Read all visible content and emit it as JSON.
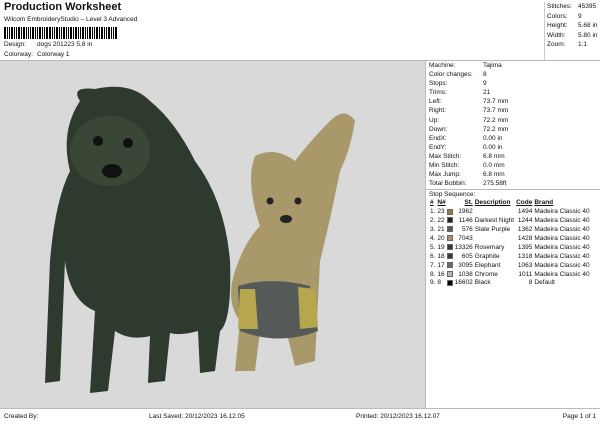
{
  "header": {
    "title": "Production Worksheet",
    "subtitle": "Wilcom EmbroideryStudio – Level 3 Advanced",
    "design_label": "Design:",
    "design_value": "dogs 201223 5,8 in",
    "colorway_label": "Colorway:",
    "colorway_value": "Colorway 1"
  },
  "stats": [
    {
      "label": "Stitches:",
      "value": "45395"
    },
    {
      "label": "Colors:",
      "value": "9"
    },
    {
      "label": "Height:",
      "value": "5.68 in"
    },
    {
      "label": "Width:",
      "value": "5.80 in"
    },
    {
      "label": "Zoom:",
      "value": "1:1"
    }
  ],
  "info": [
    {
      "label": "Machine:",
      "value": "Tajima"
    },
    {
      "label": "Color changes:",
      "value": "8"
    },
    {
      "label": "Stops:",
      "value": "9"
    },
    {
      "label": "Trims:",
      "value": "21"
    },
    {
      "label": "Left:",
      "value": "73.7 mm"
    },
    {
      "label": "Right:",
      "value": "73.7 mm"
    },
    {
      "label": "Up:",
      "value": "72.2 mm"
    },
    {
      "label": "Down:",
      "value": "72.2 mm"
    },
    {
      "label": "EndX:",
      "value": "0.00 in"
    },
    {
      "label": "EndY:",
      "value": "0.00 in"
    },
    {
      "label": "Max Stitch:",
      "value": "6.8 mm"
    },
    {
      "label": "Min Stitch:",
      "value": "0.0 mm"
    },
    {
      "label": "Max Jump:",
      "value": "6.8 mm"
    },
    {
      "label": "Total Bobbin:",
      "value": "275.58ft"
    }
  ],
  "stop_sequence": {
    "label": "Stop Sequence:",
    "headers": [
      "#",
      "N#",
      "St.",
      "Description",
      "Code",
      "Brand"
    ],
    "rows": [
      {
        "n": "1.",
        "nn": "23",
        "color": "#8c7d42",
        "st": "1962",
        "desc": "",
        "code": "1494",
        "brand": "Madeira Classic 40"
      },
      {
        "n": "2.",
        "nn": "22",
        "color": "#1e2421",
        "st": "1146",
        "desc": "Darkest Night",
        "code": "1244",
        "brand": "Madeira Classic 40"
      },
      {
        "n": "3.",
        "nn": "21",
        "color": "#56576b",
        "st": "576",
        "desc": "Slate Purple",
        "code": "1362",
        "brand": "Madeira Classic 40"
      },
      {
        "n": "4.",
        "nn": "20",
        "color": "#a39274",
        "st": "7043",
        "desc": "",
        "code": "1428",
        "brand": "Madeira Classic 40"
      },
      {
        "n": "5.",
        "nn": "19",
        "color": "#2d3a2e",
        "st": "13326",
        "desc": "Rosemary",
        "code": "1395",
        "brand": "Madeira Classic 40"
      },
      {
        "n": "6.",
        "nn": "18",
        "color": "#383c3d",
        "st": "605",
        "desc": "Graphite",
        "code": "1318",
        "brand": "Madeira Classic 40"
      },
      {
        "n": "7.",
        "nn": "17",
        "color": "#6c6f5b",
        "st": "3095",
        "desc": "Elephant",
        "code": "1063",
        "brand": "Madeira Classic 40"
      },
      {
        "n": "8.",
        "nn": "16",
        "color": "#b3bbbe",
        "st": "1038",
        "desc": "Chrome",
        "code": "1011",
        "brand": "Madeira Classic 40"
      },
      {
        "n": "9.",
        "nn": "8",
        "color": "#000000",
        "st": "16602",
        "desc": "Black",
        "code": "8",
        "brand": "Default"
      }
    ]
  },
  "footer": {
    "created_by": "Created By:",
    "last_saved": "Last Saved: 20/12/2023 16.12.05",
    "printed": "Printed: 20/12/2023 16.12.07",
    "page": "Page 1 of 1"
  }
}
